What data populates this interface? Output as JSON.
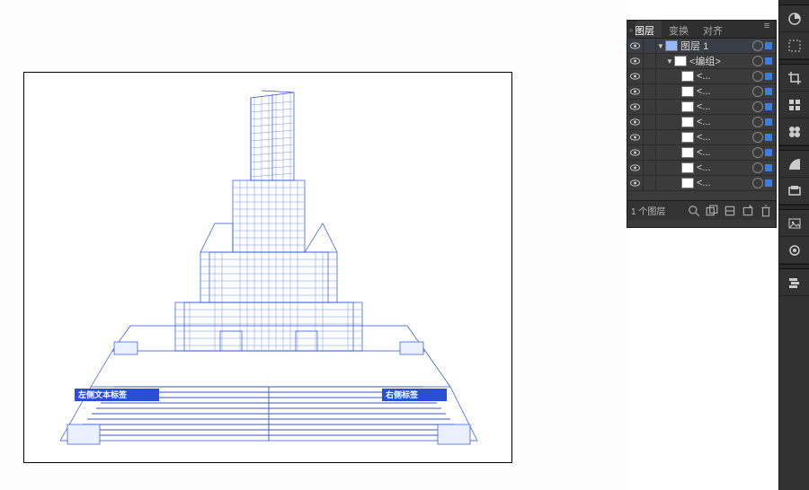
{
  "panel": {
    "tabs": {
      "layers": "图层",
      "transform": "变换",
      "align": "对齐"
    },
    "menu_glyph": "≡",
    "footer": {
      "count_label": "1 个图层"
    }
  },
  "layers": {
    "top": {
      "name": "图层",
      "num": "1"
    },
    "group": {
      "name": "<编组>"
    },
    "path_label": "<..."
  },
  "artboard": {
    "left_label": "左侧文本标签",
    "right_label": "右侧标签"
  },
  "rail": {
    "icons": [
      "color",
      "selection",
      "crop",
      "grid",
      "clover",
      "gradient",
      "rect",
      "image",
      "swatches",
      "layers-icon"
    ]
  }
}
